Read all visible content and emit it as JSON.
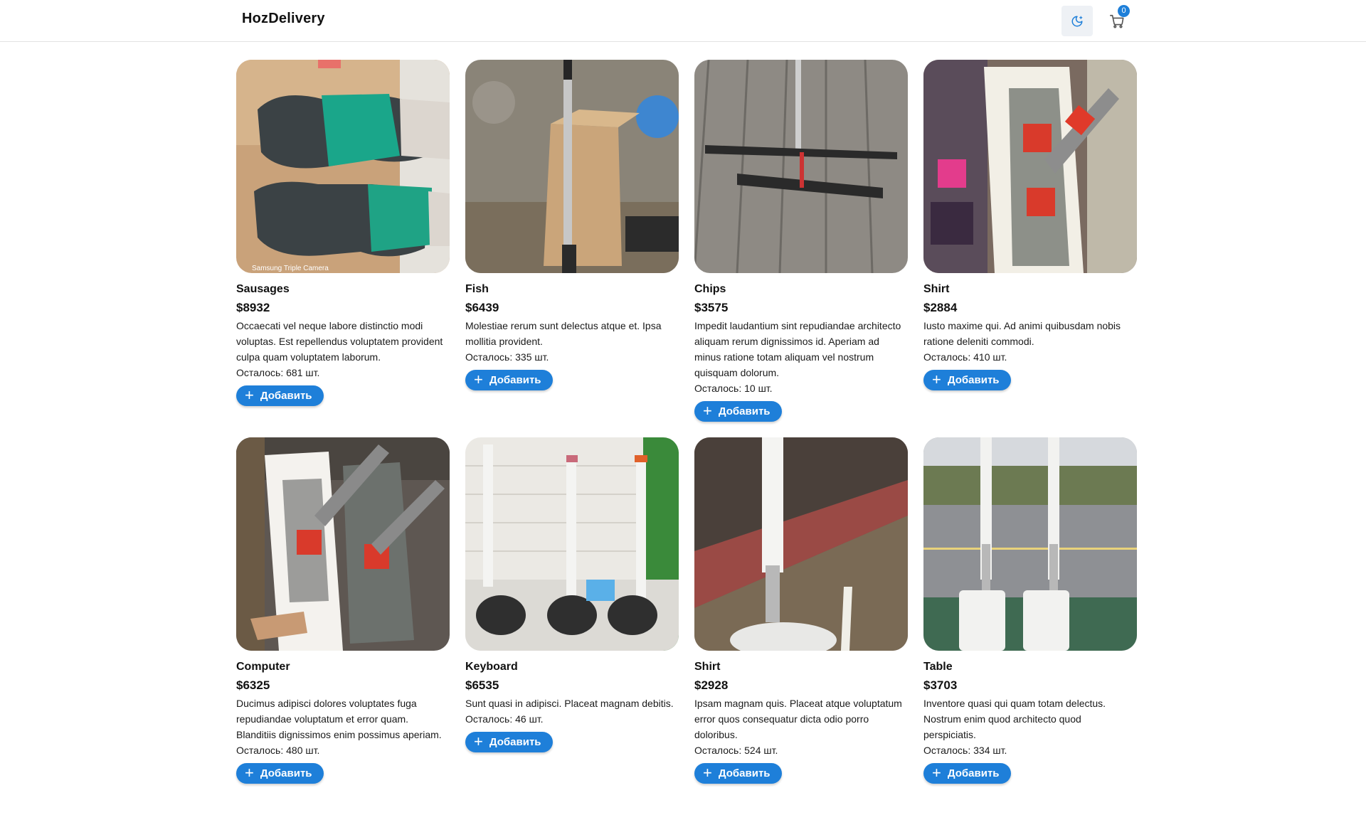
{
  "header": {
    "logo": "HozDelivery",
    "theme_toggle_icon": "moon-icon",
    "cart_icon": "cart-icon",
    "cart_count": "0"
  },
  "colors": {
    "accent": "#1e7fd9"
  },
  "products": [
    {
      "name": "Sausages",
      "price": "$8932",
      "description": "Occaecati vel neque labore distinctio modi voluptas. Est repellendus voluptatem provident culpa quam voluptatem laborum.",
      "stock": "Осталось: 681 шт.",
      "add_label": "Добавить",
      "image_caption": "Samsung Triple Camera"
    },
    {
      "name": "Fish",
      "price": "$6439",
      "description": "Molestiae rerum sunt delectus atque et. Ipsa mollitia provident.",
      "stock": "Осталось: 335 шт.",
      "add_label": "Добавить"
    },
    {
      "name": "Chips",
      "price": "$3575",
      "description": "Impedit laudantium sint repudiandae architecto aliquam rerum dignissimos id. Aperiam ad minus ratione totam aliquam vel nostrum quisquam dolorum.",
      "stock": "Осталось: 10 шт.",
      "add_label": "Добавить"
    },
    {
      "name": "Shirt",
      "price": "$2884",
      "description": "Iusto maxime qui. Ad animi quibusdam nobis ratione deleniti commodi.",
      "stock": "Осталось: 410 шт.",
      "add_label": "Добавить"
    },
    {
      "name": "Computer",
      "price": "$6325",
      "description": "Ducimus adipisci dolores voluptates fuga repudiandae voluptatum et error quam. Blanditiis dignissimos enim possimus aperiam.",
      "stock": "Осталось: 480 шт.",
      "add_label": "Добавить"
    },
    {
      "name": "Keyboard",
      "price": "$6535",
      "description": "Sunt quasi in adipisci. Placeat magnam debitis.",
      "stock": "Осталось: 46 шт.",
      "add_label": "Добавить"
    },
    {
      "name": "Shirt",
      "price": "$2928",
      "description": "Ipsam magnam quis. Placeat atque voluptatum error quos consequatur dicta odio porro doloribus.",
      "stock": "Осталось: 524 шт.",
      "add_label": "Добавить"
    },
    {
      "name": "Table",
      "price": "$3703",
      "description": "Inventore quasi qui quam totam delectus. Nostrum enim quod architecto quod perspiciatis.",
      "stock": "Осталось: 334 шт.",
      "add_label": "Добавить"
    }
  ]
}
